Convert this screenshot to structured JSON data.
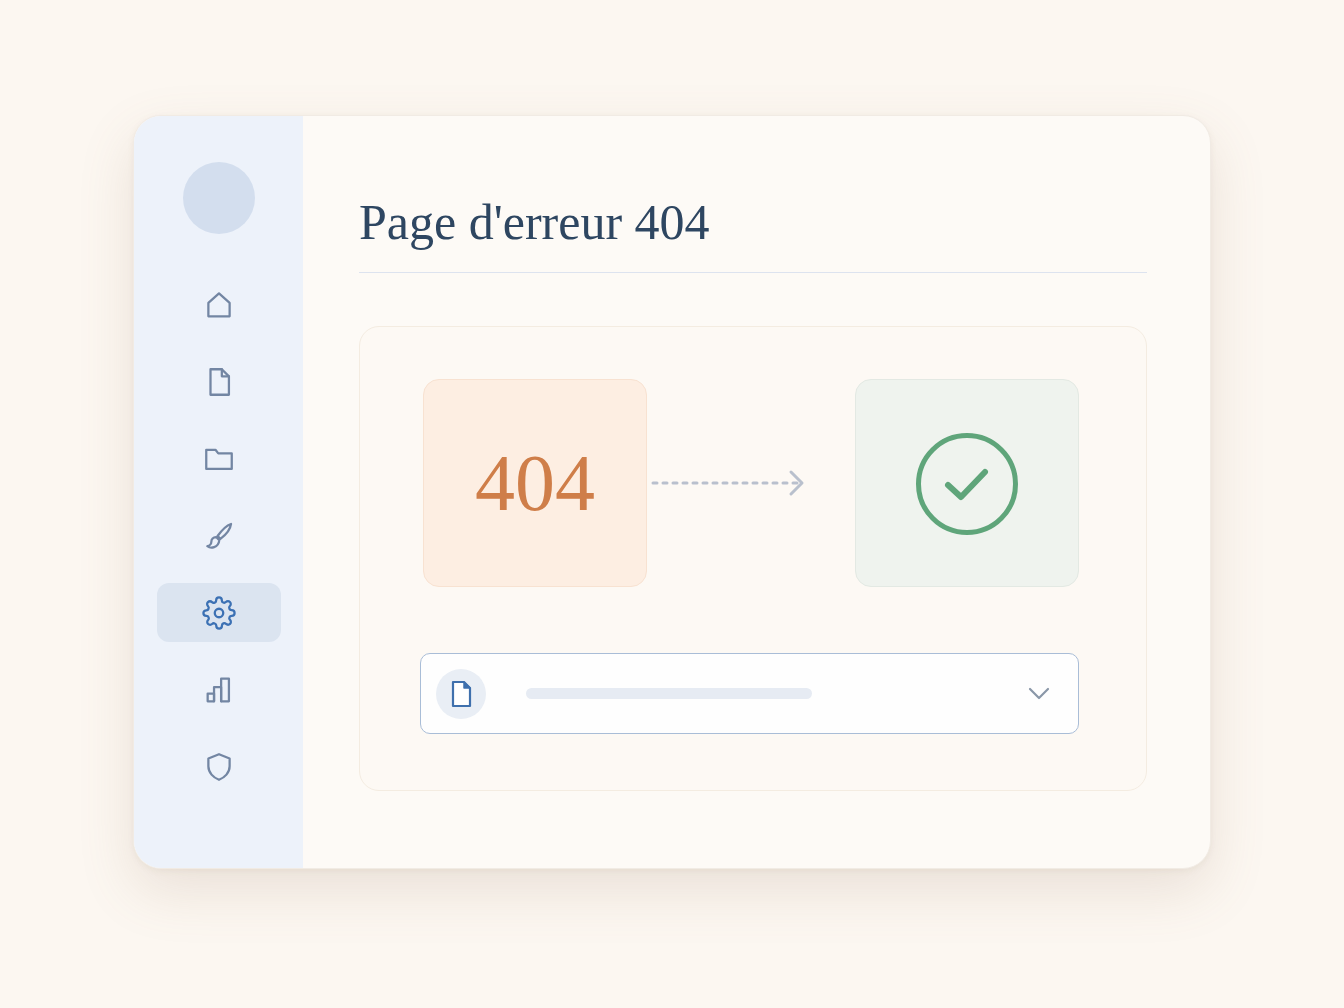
{
  "sidebar": {
    "items": [
      {
        "selected": false
      },
      {
        "selected": false
      },
      {
        "selected": false
      },
      {
        "selected": false
      },
      {
        "selected": true
      },
      {
        "selected": false
      },
      {
        "selected": false
      }
    ]
  },
  "header": {
    "title": "Page d'erreur 404"
  },
  "diagram": {
    "error_code": "404"
  }
}
